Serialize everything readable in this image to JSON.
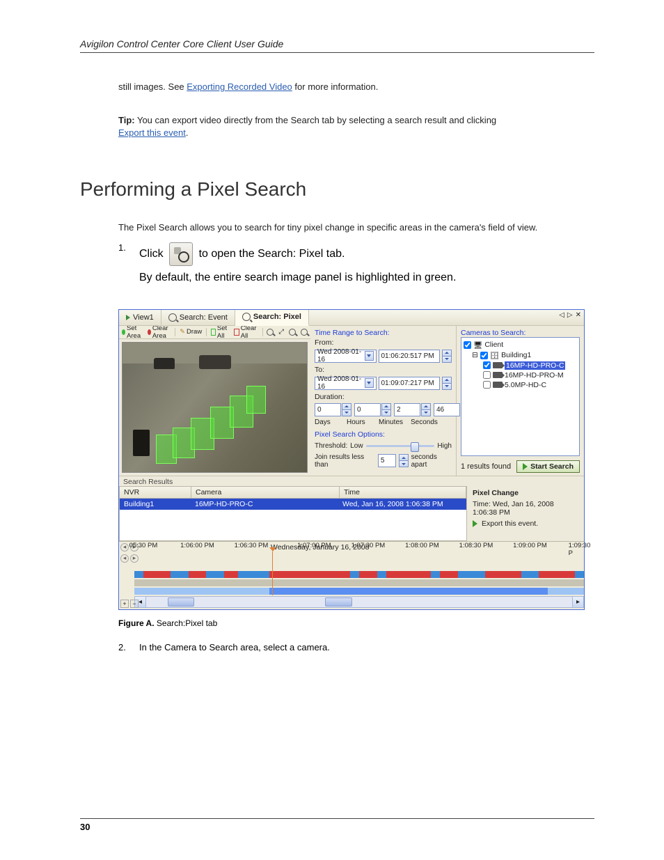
{
  "header": {
    "guide_title": "Avigilon Control Center Core Client User Guide"
  },
  "intro": {
    "line1_prefix": "still images. See ",
    "line1_link": "Exporting Recorded Video",
    "line1_suffix": " for more information.",
    "tip_label": "Tip:",
    "tip_text": " You can export video directly from the Search tab by selecting a search result and clicking ",
    "tip_link": "Export this event",
    "tip_suffix": "."
  },
  "section": {
    "title": "Performing a Pixel Search"
  },
  "para": {
    "p1": "The Pixel Search allows you to search for tiny pixel change in specific areas in the camera's field of view.",
    "step1_num": "1.",
    "step1_a": "Click ",
    "step1_b": " to open the Search: Pixel tab.",
    "step1_c": "By default, the entire search image panel is highlighted in green."
  },
  "screenshot": {
    "tabs": {
      "view1": "View1",
      "search_event": "Search: Event",
      "search_pixel": "Search: Pixel"
    },
    "tab_controls": {
      "left": "◁",
      "right": "▷",
      "close": "✕"
    },
    "toolbar": {
      "set_area": "Set Area",
      "clear_area": "Clear Area",
      "draw": "Draw",
      "set_all": "Set All",
      "clear_all": "Clear All"
    },
    "time_range": {
      "label": "Time Range to Search:",
      "from_label": "From:",
      "from_date": "Wed 2008-01-16",
      "from_time": "01:06:20:517  PM",
      "to_label": "To:",
      "to_date": "Wed 2008-01-16",
      "to_time": "01:09:07:217  PM",
      "duration_label": "Duration:",
      "days": "0",
      "hours": "0",
      "minutes": "2",
      "seconds": "46",
      "days_l": "Days",
      "hours_l": "Hours",
      "minutes_l": "Minutes",
      "seconds_l": "Seconds"
    },
    "pixel_options": {
      "label": "Pixel Search Options:",
      "threshold_label": "Threshold:",
      "low": "Low",
      "high": "High",
      "join_prefix": "Join results less than",
      "join_value": "5",
      "join_suffix": "seconds apart"
    },
    "cameras": {
      "label": "Cameras to Search:",
      "client": "Client",
      "building": "Building1",
      "cam1": "16MP-HD-PRO-C",
      "cam2": "16MP-HD-PRO-M",
      "cam3": "5.0MP-HD-C"
    },
    "results_bar": {
      "count": "1 results found",
      "start": "Start Search"
    },
    "results": {
      "label": "Search Results",
      "col_nvr": "NVR",
      "col_camera": "Camera",
      "col_time": "Time",
      "row_nvr": "Building1",
      "row_cam": "16MP-HD-PRO-C",
      "row_time": "Wed, Jan 16, 2008 1:06:38 PM"
    },
    "details": {
      "title": "Pixel Change",
      "time_label": "Time: Wed, Jan 16, 2008 1:06:38 PM",
      "export": "Export this event."
    },
    "timeline": {
      "date": "Wednesday, January 16, 2008",
      "labels": [
        "05:30 PM",
        "1:06:00 PM",
        "1:06:30 PM",
        "1:07:00 PM",
        "1:07:30 PM",
        "1:08:00 PM",
        "1:08:30 PM",
        "1:09:00 PM",
        "1:09:30 P"
      ]
    }
  },
  "figure_caption_bold": "Figure A.",
  "figure_caption_rest": " Search:Pixel tab",
  "step2_num": "2.",
  "step2_text": "In the Camera to Search area, select a camera.",
  "page_number": "30"
}
